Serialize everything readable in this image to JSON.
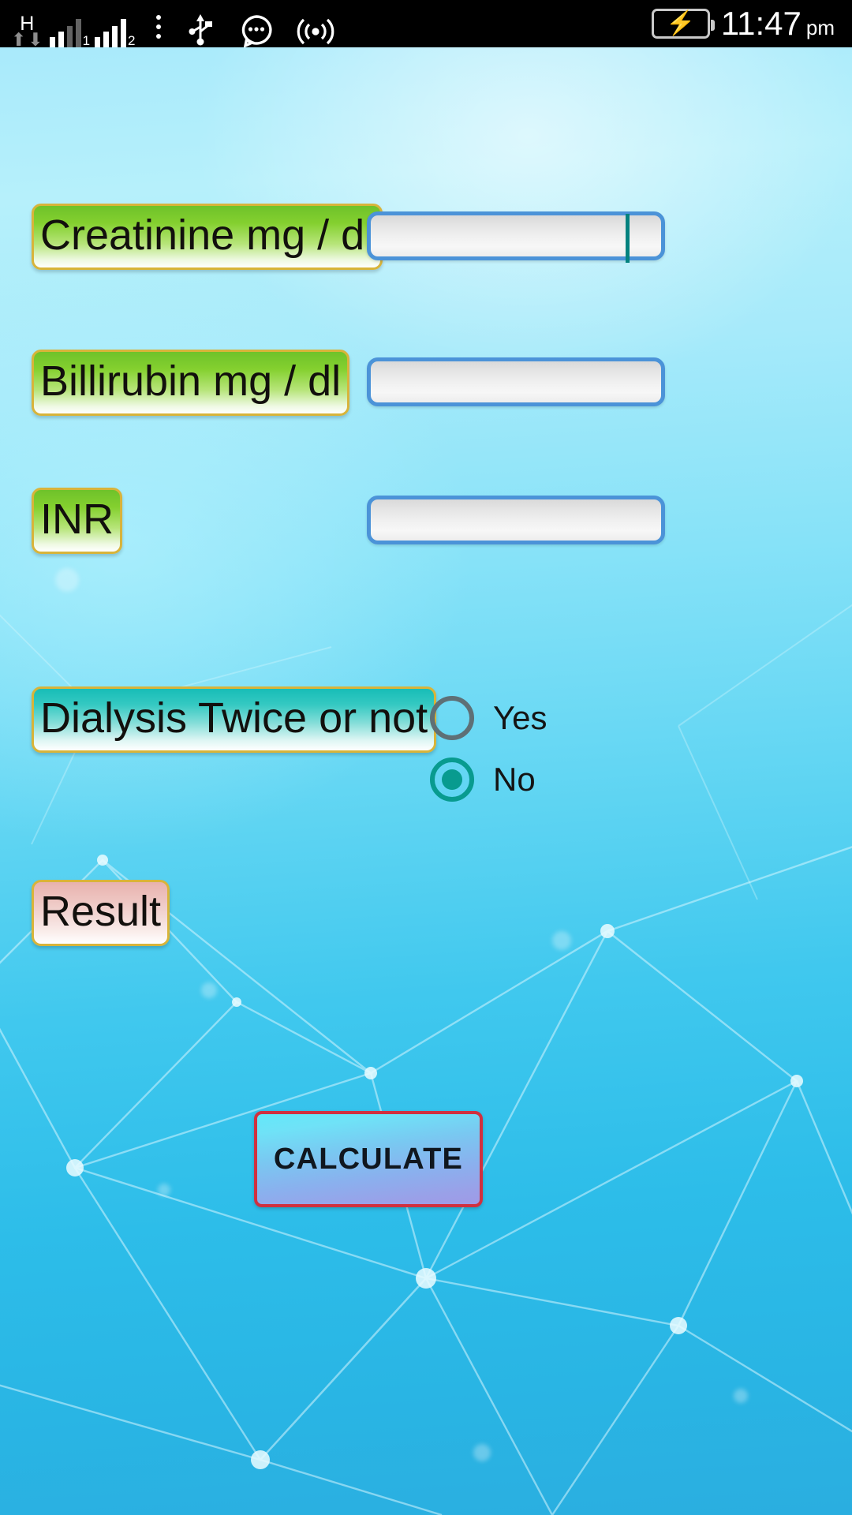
{
  "statusbar": {
    "network_type": "H",
    "arrow_up": "⬆",
    "arrow_down": "⬇",
    "sim1_label": "1",
    "sim2_label": "2",
    "icons": [
      "network-hspa-icon",
      "signal-sim1-icon",
      "signal-sim2-icon",
      "overflow-menu-icon",
      "usb-icon",
      "messages-icon",
      "hotspot-icon",
      "battery-charging-icon"
    ],
    "time": "11:47",
    "meridiem": "pm",
    "battery_state": "charging",
    "colors": {
      "bolt": "#4ddb28",
      "text": "#ffffff",
      "background": "#000000"
    }
  },
  "app": {
    "background_colors": {
      "top": "#a9eafb",
      "bottom": "#2aaee0"
    },
    "fields": [
      {
        "name": "creatinine",
        "label": "Creatinine mg / dl",
        "value": "",
        "has_caret": true
      },
      {
        "name": "billirubin",
        "label": "Billirubin mg / dl",
        "value": "",
        "has_caret": false
      },
      {
        "name": "inr",
        "label": "INR",
        "value": "",
        "has_caret": false
      }
    ],
    "dialysis": {
      "label": "Dialysis Twice or not",
      "options": [
        {
          "label": "Yes",
          "selected": false
        },
        {
          "label": "No",
          "selected": true
        }
      ]
    },
    "result": {
      "label": "Result",
      "value": ""
    },
    "calculate_button": {
      "label": "CALCULATE"
    },
    "colors": {
      "label_border": "#d8b43a",
      "label_green": "#84d02f",
      "label_teal": "#35c9c2",
      "label_pink": "#edc3bf",
      "field_border": "#4b93d8",
      "caret": "#03827f",
      "radio_selected": "#089b8f",
      "radio_unselected": "#5e7076",
      "button_border": "#d0303f"
    }
  }
}
